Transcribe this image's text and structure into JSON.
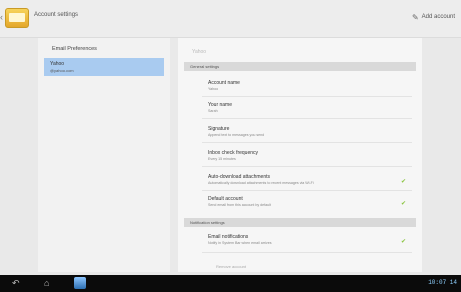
{
  "header": {
    "title": "Account settings",
    "add_account_label": "Add account",
    "add_icon": "plus-mail-icon"
  },
  "left": {
    "heading": "Email Preferences",
    "account_name": "Yahoo",
    "account_email": "@yahoo.com"
  },
  "right": {
    "tab_label": "Yahoo",
    "general_header": "General settings",
    "notification_header": "Notification settings",
    "items": [
      {
        "title": "Account name",
        "subtitle": "Yahoo"
      },
      {
        "title": "Your name",
        "subtitle": "Sarah"
      },
      {
        "title": "Signature",
        "subtitle": "Append text to messages you send"
      },
      {
        "title": "Inbox check frequency",
        "subtitle": "Every 15 minutes"
      },
      {
        "title": "Auto-download attachments",
        "subtitle": "Automatically download attachments to recent messages via Wi-Fi"
      },
      {
        "title": "Default account",
        "subtitle": "Send email from this account by default"
      },
      {
        "title": "Email notifications",
        "subtitle": "Notify in System Bar when email arrives"
      }
    ],
    "remove_label": "Remove account"
  },
  "navbar": {
    "back_icon": "back-arrow-icon",
    "home_icon": "home-icon",
    "clock": "10:07 14"
  },
  "colors": {
    "accent_selected": "#a9cbf0",
    "check": "#8ac43f"
  }
}
